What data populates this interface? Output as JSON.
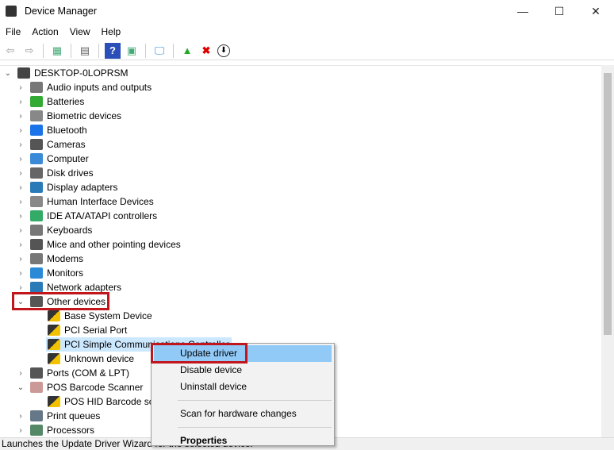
{
  "window": {
    "title": "Device Manager",
    "minimize": "—",
    "maximize": "☐",
    "close": "✕"
  },
  "menu": [
    "File",
    "Action",
    "View",
    "Help"
  ],
  "toolbar": {
    "back": "⇦",
    "forward": "⇨",
    "properties": "▤",
    "show_hide": "▦",
    "help": "?",
    "run": "▣",
    "scan": "🖵",
    "update": "▲",
    "uninstall": "✖",
    "download": "⬇"
  },
  "tree": {
    "root": "DESKTOP-0LOPRSM",
    "categories": [
      "Audio inputs and outputs",
      "Batteries",
      "Biometric devices",
      "Bluetooth",
      "Cameras",
      "Computer",
      "Disk drives",
      "Display adapters",
      "Human Interface Devices",
      "IDE ATA/ATAPI controllers",
      "Keyboards",
      "Mice and other pointing devices",
      "Modems",
      "Monitors",
      "Network adapters"
    ],
    "other": {
      "label": "Other devices",
      "children": [
        "Base System Device",
        "PCI Serial Port",
        "PCI Simple Communications Controller",
        "Unknown device"
      ]
    },
    "after": [
      {
        "label": "Ports (COM & LPT)"
      },
      {
        "label": "POS Barcode Scanner",
        "child": "POS HID Barcode scanner"
      },
      {
        "label": "Print queues"
      },
      {
        "label": "Processors"
      }
    ]
  },
  "context_menu": {
    "items": [
      "Update driver",
      "Disable device",
      "Uninstall device",
      "Scan for hardware changes",
      "Properties"
    ]
  },
  "status": "Launches the Update Driver Wizard for the selected device.",
  "colors": {
    "highlight": "#c0161c",
    "menu_active": "#91c9f7",
    "selection": "#cce8ff"
  }
}
